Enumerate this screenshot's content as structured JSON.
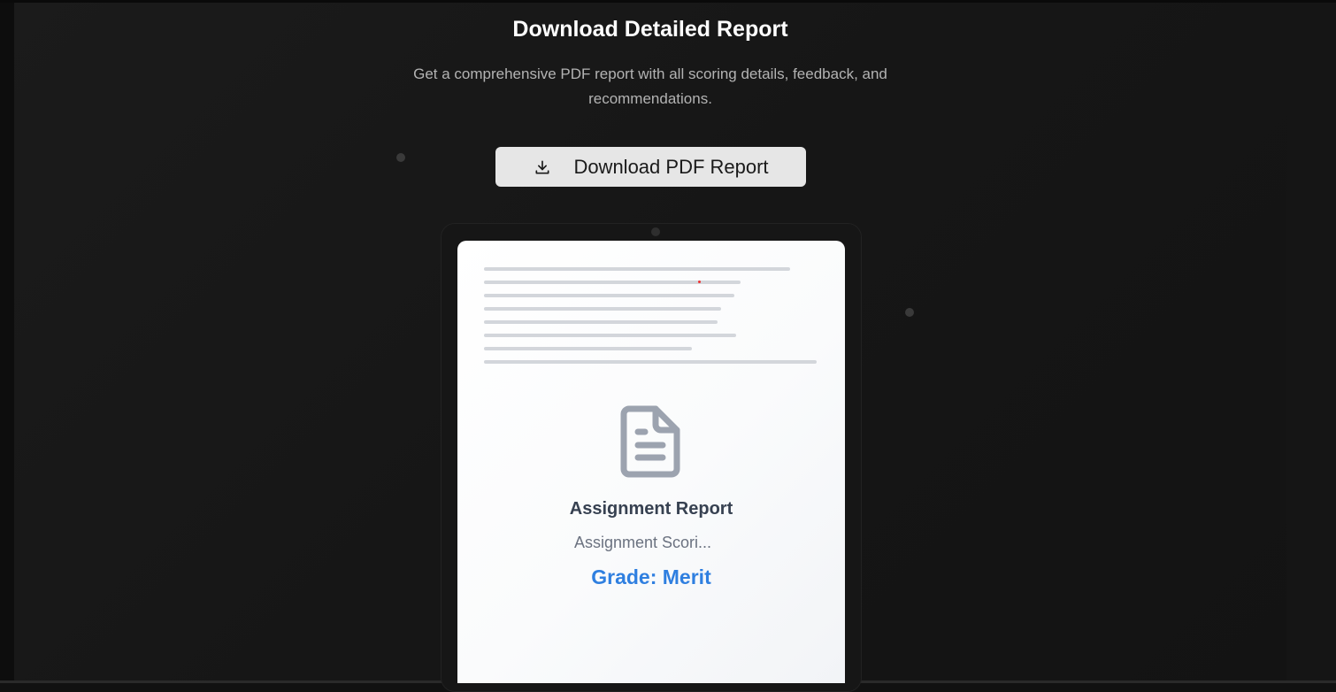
{
  "header": {
    "title": "Download Detailed Report",
    "subtitle": "Get a comprehensive PDF report with all scoring details, feedback, and recommendations."
  },
  "download_button": {
    "label": "Download PDF Report",
    "icon": "download-icon"
  },
  "preview": {
    "icon": "document-icon",
    "title": "Assignment Report",
    "subtitle": "Assignment Scori...",
    "grade": "Grade: Merit"
  },
  "colors": {
    "accent": "#2f7fe0",
    "button_bg": "#e6e6e6",
    "background": "#151515"
  }
}
